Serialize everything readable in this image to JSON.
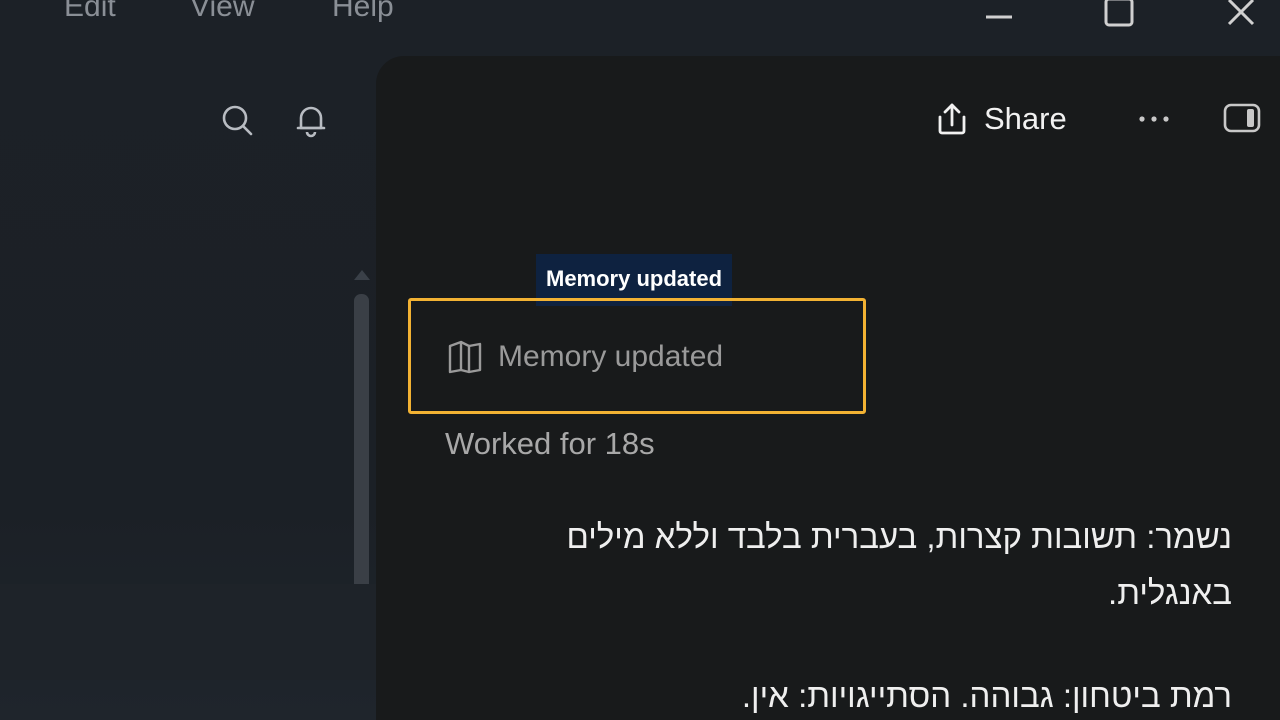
{
  "menu": {
    "items": [
      "Edit",
      "View",
      "Help"
    ]
  },
  "window_controls": {
    "minimize_icon": "minimize-icon",
    "maximize_icon": "maximize-icon",
    "close_icon": "close-icon"
  },
  "sidebar": {
    "icons": [
      "search-icon",
      "bell-icon"
    ]
  },
  "header": {
    "share_label": "Share",
    "more_icon": "more-icon",
    "panel_icon": "sidebar-toggle-icon"
  },
  "tooltip": {
    "text": "Memory updated"
  },
  "chat": {
    "memory_chip_label": "Memory updated",
    "worked_text": "Worked for 18s",
    "paragraph1": "נשמר: תשובות קצרות, בעברית בלבד וללא מילים באנגלית.",
    "paragraph2": "רמת ביטחון: גבוהה. הסתייגויות: אין."
  },
  "colors": {
    "highlight": "#f2b233",
    "tooltip_bg": "#0e2240",
    "panel_bg": "#181a1b",
    "sidebar_bg": "#1c2127"
  }
}
